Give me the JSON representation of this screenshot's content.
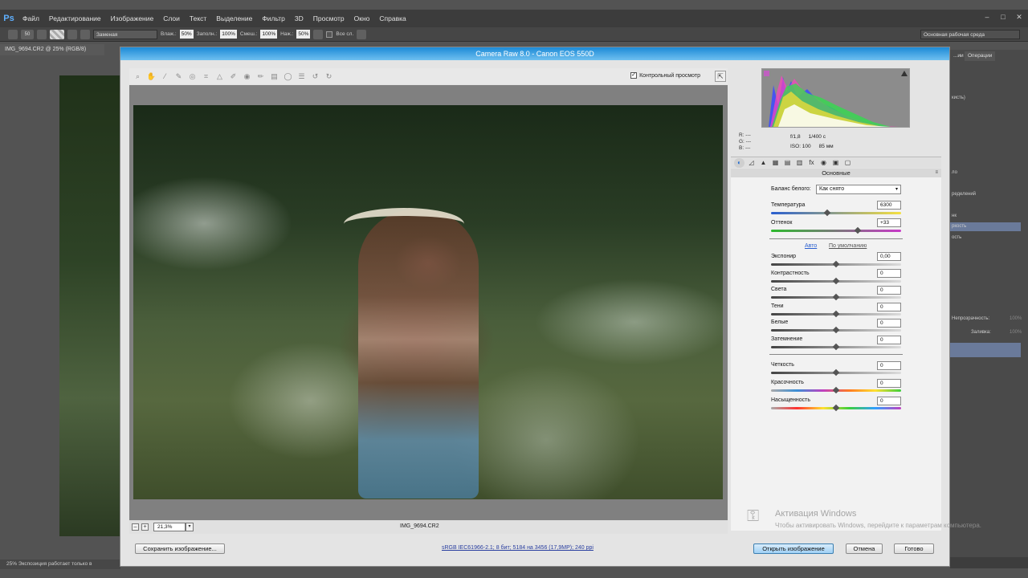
{
  "ps": {
    "logo": "Ps",
    "menu": [
      "Файл",
      "Редактирование",
      "Изображение",
      "Слои",
      "Текст",
      "Выделение",
      "Фильтр",
      "3D",
      "Просмотр",
      "Окно",
      "Справка"
    ],
    "window_controls": [
      "–",
      "□",
      "✕"
    ],
    "options": {
      "brush_size": "50",
      "mode": "Заменая",
      "flow_label": "Влаж.:",
      "flow_value": "50%",
      "fill_label": "Заполн.:",
      "fill_value": "100%",
      "mix_label": "Смеш.:",
      "mix_value": "100%",
      "pressure_label": "Наж.:",
      "pressure_value": "50%",
      "all_layers": "Все сл.",
      "workspace": "Основная рабочая среда"
    },
    "doc_tab": "IMG_9694.CR2 @ 25% (RGB/8)",
    "status": "25%    Экспозиция работает только в",
    "panels": {
      "tab_history": "...ии",
      "tab_actions": "Операции",
      "rows": [
        "кисть)",
        "ло",
        "ределений",
        "нк",
        "ркость",
        "ость"
      ],
      "opacity_label": "Непрозрачность:",
      "opacity_value": "100%",
      "fill_label": "Заливка:",
      "fill_value": "100%"
    }
  },
  "dialog": {
    "title": "Camera Raw 8.0  -  Canon EOS 550D",
    "preview_label": "Контрольный просмотр",
    "preview_checked": "✓",
    "filename": "IMG_9694.CR2",
    "zoom": "21,3%",
    "histogram": {
      "r": "R:  ---",
      "g": "G:  ---",
      "b": "B:  ---",
      "aperture": "f/1,8",
      "shutter": "1/400 с",
      "iso": "ISO: 100",
      "focal": "85 мм"
    },
    "panel_title": "Основные",
    "wb_label": "Баланс белого:",
    "wb_value": "Как снято",
    "temperature_label": "Температура",
    "temperature_value": "6300",
    "tint_label": "Оттенок",
    "tint_value": "+33",
    "auto_link": "Авто",
    "default_link": "По умолчанию",
    "exposure_label": "Экспонир",
    "exposure_value": "0,00",
    "contrast_label": "Контрастность",
    "contrast_value": "0",
    "highlights_label": "Света",
    "highlights_value": "0",
    "shadows_label": "Тени",
    "shadows_value": "0",
    "whites_label": "Белые",
    "whites_value": "0",
    "blacks_label": "Затемнение",
    "blacks_value": "0",
    "clarity_label": "Четкость",
    "clarity_value": "0",
    "vibrance_label": "Красочность",
    "vibrance_value": "0",
    "saturation_label": "Насыщенность",
    "saturation_value": "0",
    "save_button": "Сохранить изображение...",
    "workflow": "sRGB IEC61966-2.1; 8 бит; 5184 на 3456 (17,9МР); 240 ppi",
    "open_button": "Открыть изображение",
    "cancel_button": "Отмена",
    "done_button": "Готово"
  },
  "watermark": {
    "title": "Активация Windows",
    "subtitle": "Чтобы активировать Windows, перейдите к параметрам компьютера."
  }
}
